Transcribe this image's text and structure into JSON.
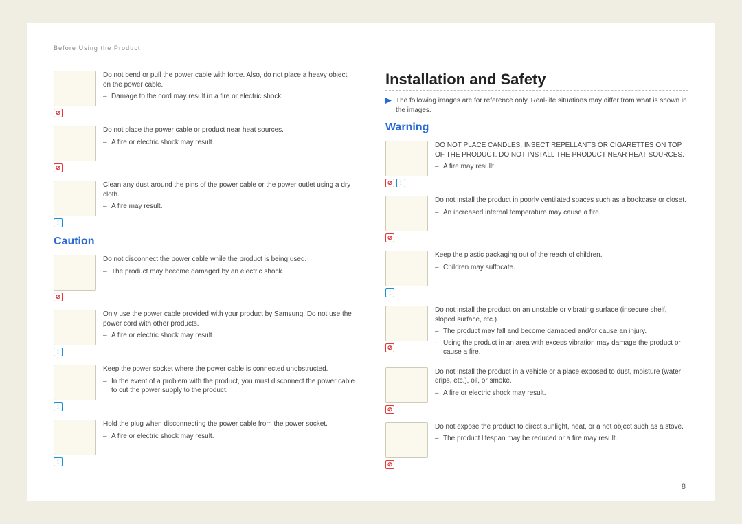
{
  "header": {
    "section": "Before Using the Product"
  },
  "page_number": "8",
  "left": {
    "items": [
      {
        "lead": "Do not bend or pull the power cable with force. Also, do not place a heavy object on the power cable.",
        "subs": [
          "Damage to the cord may result in a fire or electric shock."
        ],
        "badges": [
          "prohibit"
        ]
      },
      {
        "lead": "Do not place the power cable or product near heat sources.",
        "subs": [
          "A fire or electric shock may result."
        ],
        "badges": [
          "prohibit"
        ]
      },
      {
        "lead": "Clean any dust around the pins of the power cable or the power outlet using a dry cloth.",
        "subs": [
          "A fire may result."
        ],
        "badges": [
          "info"
        ]
      }
    ],
    "caution_heading": "Caution",
    "caution_items": [
      {
        "lead": "Do not disconnect the power cable while the product is being used.",
        "subs": [
          "The product may become damaged by an electric shock."
        ],
        "badges": [
          "prohibit"
        ]
      },
      {
        "lead": "Only use the power cable provided with your product by Samsung. Do not use the power cord with other products.",
        "subs": [
          "A fire or electric shock may result."
        ],
        "badges": [
          "info"
        ]
      },
      {
        "lead": "Keep the power socket where the power cable is connected unobstructed.",
        "subs": [
          "In the event of a problem with the product, you must disconnect the power cable to cut the power supply to the product."
        ],
        "badges": [
          "info"
        ]
      },
      {
        "lead": "Hold the plug when disconnecting the power cable from the power socket.",
        "subs": [
          "A fire or electric shock may result."
        ],
        "badges": [
          "info"
        ]
      }
    ]
  },
  "right": {
    "install_heading": "Installation and Safety",
    "note": "The following images are for reference only. Real-life situations may differ from what is shown in the images.",
    "warning_heading": "Warning",
    "items": [
      {
        "lead": "DO NOT PLACE CANDLES, INSECT REPELLANTS OR CIGARETTES ON TOP OF THE PRODUCT. DO NOT INSTALL THE PRODUCT NEAR HEAT SOURCES.",
        "subs": [
          "A fire may resullt."
        ],
        "badges": [
          "prohibit",
          "info"
        ]
      },
      {
        "lead": "Do not install the product in poorly ventilated spaces such as a bookcase or closet.",
        "subs": [
          "An increased internal temperature may cause a fire."
        ],
        "badges": [
          "prohibit"
        ]
      },
      {
        "lead": "Keep the plastic packaging out of the reach of children.",
        "subs": [
          "Children may suffocate."
        ],
        "badges": [
          "info"
        ]
      },
      {
        "lead": "Do not install the product on an unstable or vibrating surface (insecure shelf, sloped surface, etc.)",
        "subs": [
          "The product may fall and become damaged and/or cause an injury.",
          "Using the product in an area with excess vibration may damage the product or cause a fire."
        ],
        "badges": [
          "prohibit"
        ]
      },
      {
        "lead": "Do not install the product in a vehicle or a place exposed to dust, moisture (water drips, etc.), oil, or smoke.",
        "subs": [
          "A fire or electric shock may result."
        ],
        "badges": [
          "prohibit"
        ]
      },
      {
        "lead": "Do not expose the product to direct sunlight, heat, or a hot object such as a stove.",
        "subs": [
          "The product lifespan may be reduced or a fire may result."
        ],
        "badges": [
          "prohibit"
        ]
      }
    ]
  }
}
